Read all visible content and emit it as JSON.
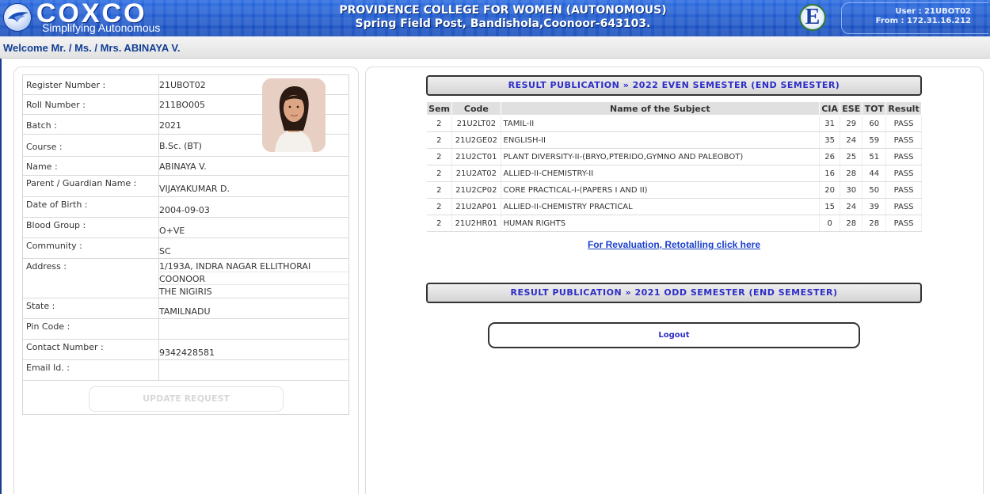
{
  "header": {
    "brand_name": "COXCO",
    "brand_tagline": "Simplifying Autonomous",
    "college_name": "PROVIDENCE COLLEGE FOR WOMEN (AUTONOMOUS)",
    "college_address": "Spring Field Post, Bandishola,Coonoor-643103.",
    "ecap_logo": "E",
    "user_label": "User : 21UBOT02",
    "from_label": "From : 172.31.16.212",
    "icons": [
      "coxco-bird-logo-icon",
      "ecap-logo-icon"
    ]
  },
  "welcome": {
    "text": "Welcome Mr. / Ms. / Mrs. ABINAYA V."
  },
  "profile": {
    "rows": [
      {
        "label": "Register Number :",
        "value": "21UBOT02"
      },
      {
        "label": "Roll Number :",
        "value": "211BO005"
      },
      {
        "label": "Batch :",
        "value": "2021"
      },
      {
        "label": "Course :",
        "value": "B.Sc. (BT)"
      },
      {
        "label": "Name :",
        "value": "ABINAYA V."
      },
      {
        "label": "Parent / Guardian Name :",
        "value": "VIJAYAKUMAR D."
      },
      {
        "label": "Date of Birth :",
        "value": "2004-09-03"
      },
      {
        "label": "Blood Group :",
        "value": "O+VE"
      },
      {
        "label": "Community :",
        "value": "SC"
      },
      {
        "label": "Address :",
        "value": "1/193A, INDRA NAGAR ELLITHORAI",
        "value2": "COONOOR",
        "value3": "THE NIGIRIS"
      },
      {
        "label": "State :",
        "value": "TAMILNADU"
      },
      {
        "label": "Pin Code :",
        "value": ""
      },
      {
        "label": "Contact Number :",
        "value": "9342428581"
      },
      {
        "label": "Email Id. :",
        "value": ""
      }
    ],
    "update_button": "UPDATE REQUEST"
  },
  "results": {
    "even_title": "RESULT PUBLICATION  » 2022 EVEN SEMESTER (END SEMESTER)",
    "odd_title": "RESULT PUBLICATION  » 2021 ODD SEMESTER (END SEMESTER)",
    "columns": [
      "Sem",
      "Code",
      "Name of the Subject",
      "CIA",
      "ESE",
      "TOT",
      "Result"
    ],
    "rows": [
      [
        "2",
        "21U2LT02",
        "TAMIL-II",
        "31",
        "29",
        "60",
        "PASS"
      ],
      [
        "2",
        "21U2GE02",
        "ENGLISH-II",
        "35",
        "24",
        "59",
        "PASS"
      ],
      [
        "2",
        "21U2CT01",
        "PLANT DIVERSITY-II-(BRYO,PTERIDO,GYMNO AND PALEOBOT)",
        "26",
        "25",
        "51",
        "PASS"
      ],
      [
        "2",
        "21U2AT02",
        "ALLIED-II-CHEMISTRY-II",
        "16",
        "28",
        "44",
        "PASS"
      ],
      [
        "2",
        "21U2CP02",
        "CORE PRACTICAL-I-(PAPERS I AND II)",
        "20",
        "30",
        "50",
        "PASS"
      ],
      [
        "2",
        "21U2AP01",
        "ALLIED-II-CHEMISTRY PRACTICAL",
        "15",
        "24",
        "39",
        "PASS"
      ],
      [
        "2",
        "21U2HR01",
        "HUMAN RIGHTS",
        "0",
        "28",
        "28",
        "PASS"
      ]
    ],
    "revaluation_link": "For Revaluation, Retotalling click here",
    "logout_button": "Logout"
  }
}
